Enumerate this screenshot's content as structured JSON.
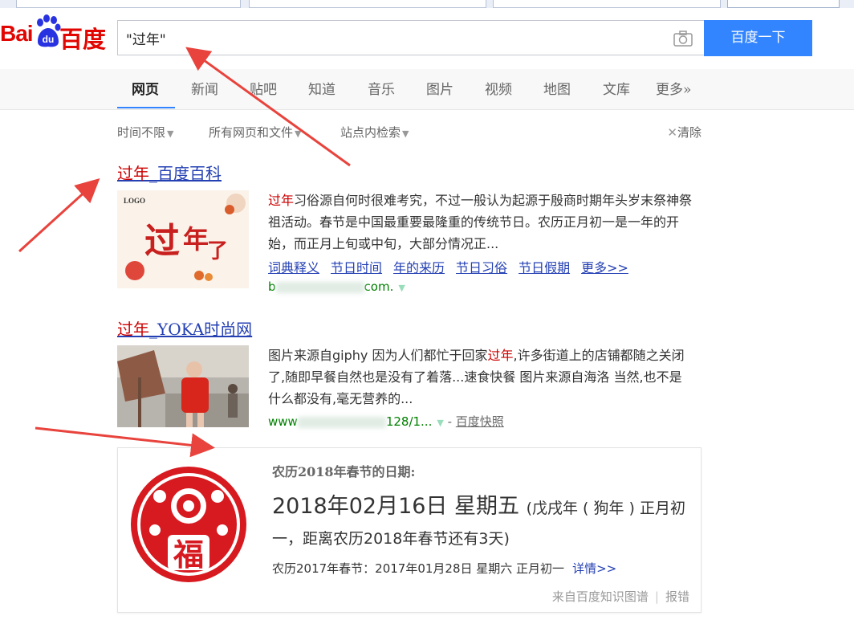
{
  "logo": {
    "bai": "Bai",
    "du": "百度"
  },
  "search": {
    "query": "\"过年\"",
    "button_label": "百度一下"
  },
  "nav": {
    "items": [
      {
        "label": "网页",
        "active": true
      },
      {
        "label": "新闻"
      },
      {
        "label": "贴吧"
      },
      {
        "label": "知道"
      },
      {
        "label": "音乐"
      },
      {
        "label": "图片"
      },
      {
        "label": "视频"
      },
      {
        "label": "地图"
      },
      {
        "label": "文库"
      },
      {
        "label": "更多»"
      }
    ]
  },
  "filters": {
    "time": "时间不限",
    "filetype": "所有网页和文件",
    "site": "站点内检索",
    "clear": "清除"
  },
  "results": [
    {
      "title_em": "过年",
      "title_rest": "_百度百科",
      "snippet_em": "过年",
      "snippet_rest": "习俗源自何时很难考究，不过一般认为起源于殷商时期年头岁末祭神祭祖活动。春节是中国最重要最隆重的传统节日。农历正月初一是一年的开始，而正月上旬或中旬，大部分情况正...",
      "links": [
        "词典释义",
        "节日时间",
        "年的来历",
        "节日习俗",
        "节日假期",
        "更多>>"
      ],
      "url_start": "b",
      "url_end": "com."
    },
    {
      "title_em": "过年",
      "title_rest": "_YOKA时尚网",
      "snippet_pre": "图片来源自giphy 因为人们都忙于回家",
      "snippet_em": "过年",
      "snippet_post": ",许多街道上的店铺都随之关闭了,随即早餐自然也是没有了着落...速食快餐 图片来源自海洛 当然,也不是什么都没有,毫无营养的...",
      "url_start": "www",
      "url_end": "128/1...",
      "snapshot": "百度快照"
    }
  ],
  "card": {
    "heading": "农历2018年春节的日期:",
    "date": "2018年02月16日 星期五",
    "date_detail": "(戊戌年 ( 狗年 ) 正月初",
    "line2": "一，距离农历2018年春节还有3天)",
    "prev": "农历2017年春节：2017年01月28日 星期六 正月初一",
    "detail_link": "详情>>",
    "source": "来自百度知识图谱",
    "report": "报错"
  },
  "colors": {
    "accent": "#3385ff",
    "brand": "#e10602",
    "link": "#2440b3",
    "highlight": "#cc0000",
    "annotation": "#e8433c"
  },
  "icons": [
    "baidu-paw-icon",
    "camera-icon",
    "close-icon",
    "dropdown-triangle-icon",
    "fu-papercut-seal"
  ]
}
